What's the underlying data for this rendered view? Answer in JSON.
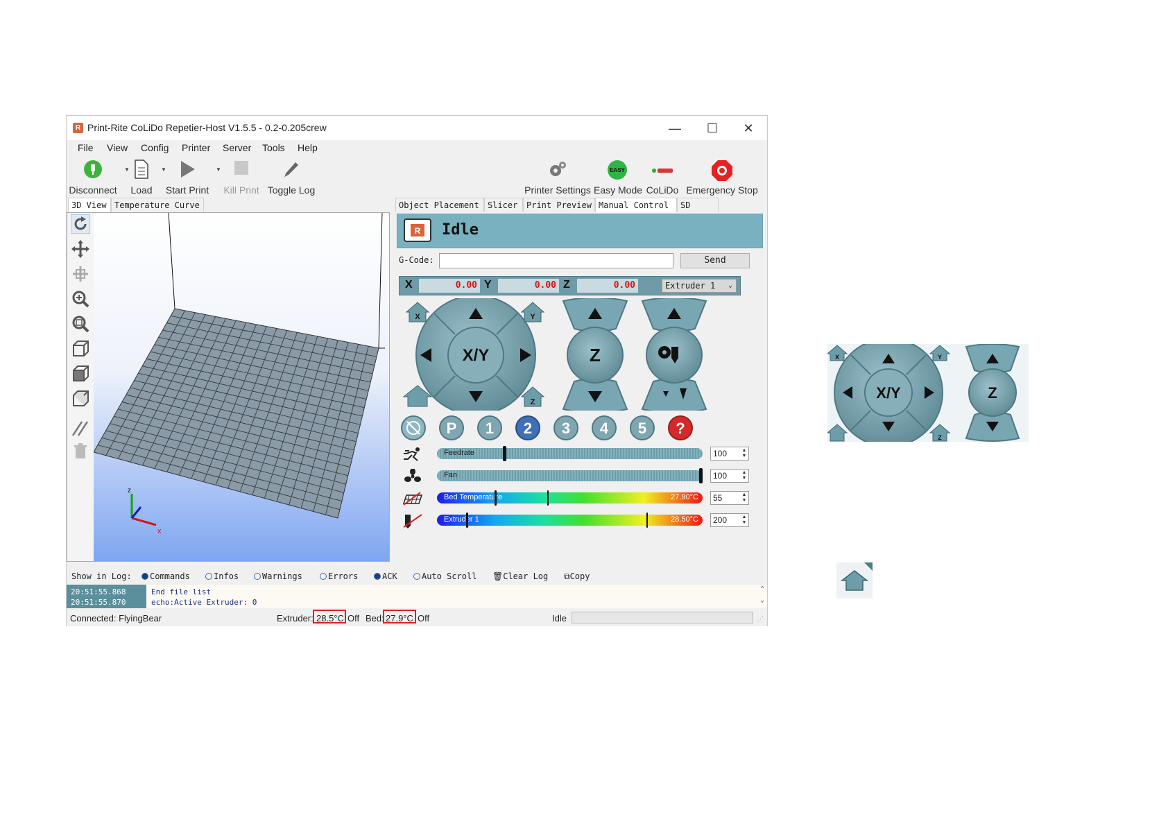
{
  "window": {
    "title": "Print-Rite CoLiDo Repetier-Host V1.5.5 - 0.2-0.205crew",
    "minimize": "—",
    "maximize": "☐",
    "close": "✕"
  },
  "menu": [
    "File",
    "View",
    "Config",
    "Printer",
    "Server",
    "Tools",
    "Help"
  ],
  "toolbar": {
    "disconnect": "Disconnect",
    "load": "Load",
    "start_print": "Start Print",
    "kill_print": "Kill Print",
    "toggle_log": "Toggle Log",
    "printer_settings": "Printer Settings",
    "easy_mode": "Easy Mode",
    "easy_badge": "EASY",
    "colido": "CoLiDo",
    "emergency_stop": "Emergency Stop"
  },
  "left_tabs": [
    "3D View",
    "Temperature Curve"
  ],
  "right_tabs": [
    "Object Placement",
    "Slicer",
    "Print Preview",
    "Manual Control",
    "SD Card"
  ],
  "status_banner": "Idle",
  "gcode": {
    "label": "G-Code:",
    "value": "",
    "send": "Send"
  },
  "coords": {
    "x_label": "X",
    "x_value": "0.00",
    "y_label": "Y",
    "y_value": "0.00",
    "z_label": "Z",
    "z_value": "0.00",
    "extruder_select": "Extruder 1"
  },
  "jog": {
    "xy_label": "X/Y",
    "z_label": "Z",
    "home_x": "X",
    "home_y": "Y",
    "home_z": "Z"
  },
  "macros": [
    "P",
    "1",
    "2",
    "3",
    "4",
    "5",
    "?"
  ],
  "sliders": {
    "feedrate": {
      "label": "Feedrate",
      "value": "100",
      "fraction": 0.25
    },
    "fan": {
      "label": "Fan",
      "value": "100",
      "fraction": 1.0
    },
    "bed": {
      "label": "Bed Temperature",
      "reading": "27.90°C",
      "value": "55",
      "target_fraction": 0.42,
      "current_fraction": 0.22
    },
    "extruder": {
      "label": "Extruder 1",
      "reading": "28.50°C",
      "value": "200",
      "target_fraction": 0.8,
      "current_fraction": 0.11
    }
  },
  "log": {
    "show_label": "Show in Log:",
    "options": [
      {
        "label": "Commands",
        "on": true
      },
      {
        "label": "Infos",
        "on": false
      },
      {
        "label": "Warnings",
        "on": false
      },
      {
        "label": "Errors",
        "on": false
      },
      {
        "label": "ACK",
        "on": true
      },
      {
        "label": "Auto Scroll",
        "on": false
      }
    ],
    "clear": "Clear Log",
    "copy": "Copy",
    "lines": [
      {
        "time": "20:51:55.868",
        "msg": "End file list"
      },
      {
        "time": "20:51:55.870",
        "msg": "echo:Active Extruder: 0"
      }
    ]
  },
  "statusbar": {
    "connected": "Connected: FlyingBear",
    "extruder_label": "Extruder:",
    "extruder_temp": "28.5°C",
    "extruder_state": "Off",
    "bed_label": "Bed:",
    "bed_temp": "27.9°C",
    "bed_state": "Off",
    "state": "Idle"
  },
  "colors": {
    "accent": "#7ab1c0",
    "jog_blue": "#6e9daa",
    "coord_red": "#dd1111",
    "highlight": "#dd2222"
  }
}
